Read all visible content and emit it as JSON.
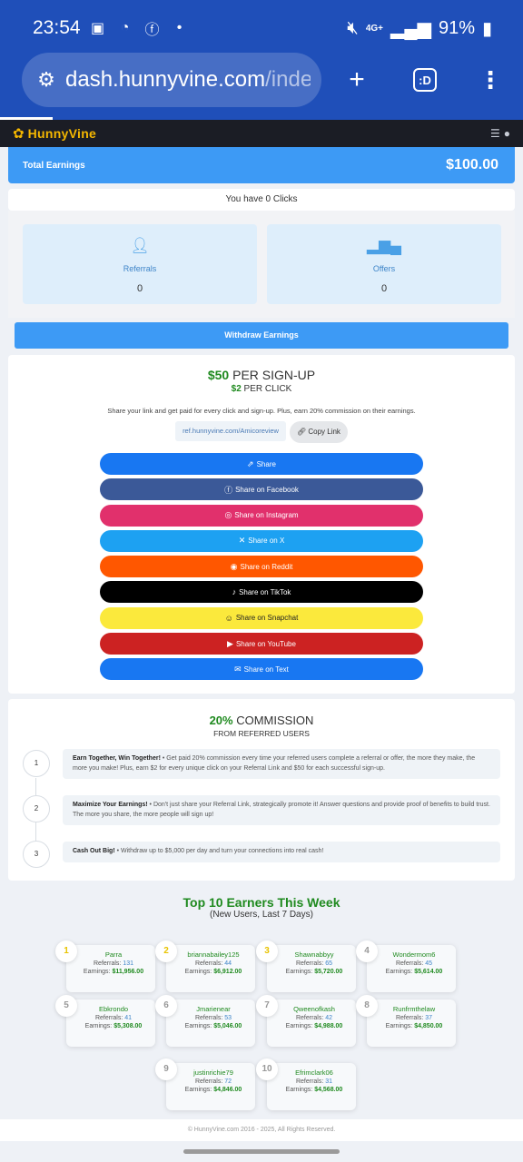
{
  "status_bar": {
    "time": "23:54",
    "network": "4G+",
    "battery": "91%"
  },
  "browser": {
    "url_host": "dash.hunnyvine.com",
    "url_path": "/inde",
    "tab_label": ":D"
  },
  "site": {
    "logo_text": "HunnyVine"
  },
  "earnings": {
    "label": "Total Earnings",
    "amount": "$100.00"
  },
  "clicks_text": "You have 0 Clicks",
  "stats": [
    {
      "label": "Referrals",
      "value": "0",
      "icon": "add-user-icon"
    },
    {
      "label": "Offers",
      "value": "0",
      "icon": "bar-chart-icon"
    }
  ],
  "withdraw_label": "Withdraw Earnings",
  "promo": {
    "signup_amount": "$50",
    "signup_text": " PER SIGN-UP",
    "click_amount": "$2",
    "click_text": " PER CLICK",
    "description": "Share your link and get paid for every click and sign-up. Plus, earn 20% commission on their earnings.",
    "ref_link": "ref.hunnyvine.com/Amicoreview",
    "copy_label": "Copy Link"
  },
  "share_buttons": [
    {
      "label": "Share",
      "color": "#1877f2",
      "icon": "share-icon"
    },
    {
      "label": "Share on Facebook",
      "color": "#3b5998",
      "icon": "facebook-icon"
    },
    {
      "label": "Share on Instagram",
      "color": "#e1306c",
      "icon": "instagram-icon"
    },
    {
      "label": "Share on X",
      "color": "#1da1f2",
      "icon": "x-icon"
    },
    {
      "label": "Share on Reddit",
      "color": "#ff5700",
      "icon": "reddit-icon"
    },
    {
      "label": "Share on TikTok",
      "color": "#000000",
      "icon": "tiktok-icon"
    },
    {
      "label": "Share on Snapchat",
      "color": "#fbe93c",
      "icon": "snapchat-icon"
    },
    {
      "label": "Share on YouTube",
      "color": "#cc2222",
      "icon": "youtube-icon"
    },
    {
      "label": "Share on Text",
      "color": "#1877f2",
      "icon": "message-icon"
    }
  ],
  "commission": {
    "pct": "20%",
    "title": " COMMISSION",
    "subtitle": "FROM REFERRED USERS",
    "steps": [
      {
        "num": "1",
        "title": "Earn Together, Win Together!",
        "text": " • Get paid 20% commission every time your referred users complete a referral or offer, the more they make, the more you make! Plus, earn $2 for every unique click on your Referral Link and $50 for each successful sign-up."
      },
      {
        "num": "2",
        "title": "Maximize Your Earnings!",
        "text": " • Don't just share your Referral Link, strategically promote it! Answer questions and provide proof of benefits to build trust. The more you share, the more people will sign up!"
      },
      {
        "num": "3",
        "title": "Cash Out Big!",
        "text": " • Withdraw up to $5,000 per day and turn your connections into real cash!"
      }
    ]
  },
  "leaderboard": {
    "title": "Top 10 Earners This Week",
    "subtitle": "(New Users, Last 7 Days)",
    "referrals_label": "Referrals: ",
    "earnings_label": "Earnings: ",
    "entries": [
      {
        "rank": "1",
        "name": "Parra",
        "referrals": "131",
        "earnings": "$11,956.00"
      },
      {
        "rank": "2",
        "name": "briannabailey125",
        "referrals": "44",
        "earnings": "$6,912.00"
      },
      {
        "rank": "3",
        "name": "Shawnabbyy",
        "referrals": "65",
        "earnings": "$5,720.00"
      },
      {
        "rank": "4",
        "name": "Wondermom6",
        "referrals": "45",
        "earnings": "$5,614.00"
      },
      {
        "rank": "5",
        "name": "Ebkrondo",
        "referrals": "41",
        "earnings": "$5,308.00"
      },
      {
        "rank": "6",
        "name": "Jmarienear",
        "referrals": "53",
        "earnings": "$5,046.00"
      },
      {
        "rank": "7",
        "name": "Qweenofkash",
        "referrals": "42",
        "earnings": "$4,988.00"
      },
      {
        "rank": "8",
        "name": "Runfrmthelaw",
        "referrals": "37",
        "earnings": "$4,850.00"
      },
      {
        "rank": "9",
        "name": "justinrichie79",
        "referrals": "72",
        "earnings": "$4,846.00"
      },
      {
        "rank": "10",
        "name": "Efrimclark06",
        "referrals": "31",
        "earnings": "$4,568.00"
      }
    ]
  },
  "footer": "© HunnyVine.com 2016 - 2025, All Rights Reserved."
}
